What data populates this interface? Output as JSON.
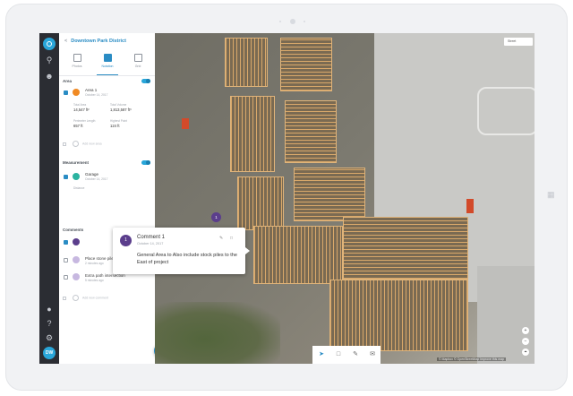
{
  "project": {
    "back": "<",
    "title": "Downtown Park District"
  },
  "tabs": [
    {
      "label": "Photos"
    },
    {
      "label": "Notation"
    },
    {
      "label": "Grid"
    }
  ],
  "area_section": {
    "label": "Area"
  },
  "area_item": {
    "title": "Area 1",
    "date": "October 14, 2017",
    "stats": [
      {
        "label": "Total Area",
        "value": "14,547 ft²"
      },
      {
        "label": "Total Volume",
        "value": "1,813,587 ft³"
      },
      {
        "label": "Perimeter Length",
        "value": "657 ft"
      },
      {
        "label": "Highest Point",
        "value": "124 ft"
      }
    ]
  },
  "area_add": "Add new area",
  "measurement_section": {
    "label": "Measurement"
  },
  "measurement_item": {
    "title": "Garage",
    "date": "October 14, 2017",
    "stat_label": "Distance"
  },
  "comments_section": {
    "label": "Comments"
  },
  "comments": [
    {
      "title": "Place stone pile here",
      "date": "2 minutes ago"
    },
    {
      "title": "Extra path intersection",
      "date": "5 minutes ago"
    }
  ],
  "comment_add": "Add new comment",
  "popup": {
    "avatar": "1",
    "title": "Comment 1",
    "date": "October 14, 2017",
    "body": "General Area to Also include stock piles to the East of project"
  },
  "map": {
    "dropdown": "Street",
    "marker": "1",
    "attribution": "© Mapbox © OpenStreetMap  Improve this map",
    "zoom": [
      "+",
      "−",
      "⌖"
    ]
  },
  "rail": {
    "avatar": "DW"
  },
  "colors": {
    "accent": "#2a8cc4",
    "comment": "#5b3e8c",
    "area": "#f08a24",
    "measurement": "#2bb3a0"
  }
}
